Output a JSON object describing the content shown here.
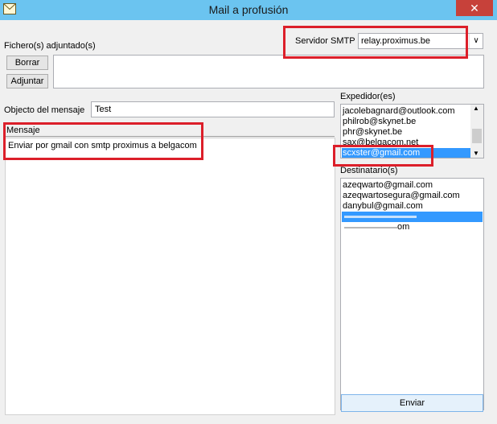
{
  "window": {
    "title": "Mail a profusión",
    "close_glyph": "✕"
  },
  "attachments": {
    "label": "Fichero(s) adjuntado(s)",
    "delete_button": "Borrar",
    "attach_button": "Adjuntar"
  },
  "smtp": {
    "label": "Servidor SMTP",
    "value": "relay.proximus.be",
    "dropdown_glyph": "∨"
  },
  "subject": {
    "label": "Objecto del mensaje",
    "value": "Test"
  },
  "message": {
    "label": "Mensaje",
    "body": "Enviar por gmail con smtp proximus a belgacom"
  },
  "senders": {
    "label": "Expedidor(es)",
    "items": [
      "jacolebagnard@outlook.com",
      "philrob@skynet.be",
      "phr@skynet.be",
      "sax@belgacom.net",
      "scxster@gmail.com"
    ],
    "selected": "scxster@gmail.com"
  },
  "recipients": {
    "label": "Destinatario(s)",
    "items": [
      "azeqwarto@gmail.com",
      "azeqwartosegura@gmail.com",
      "danybul@gmail.com",
      "",
      "om"
    ]
  },
  "send_button": "Enviar",
  "colors": {
    "title_bar": "#6bc4f0",
    "close_button": "#c7413a",
    "highlight": "#dc1f2a",
    "selection": "#3399ff"
  }
}
